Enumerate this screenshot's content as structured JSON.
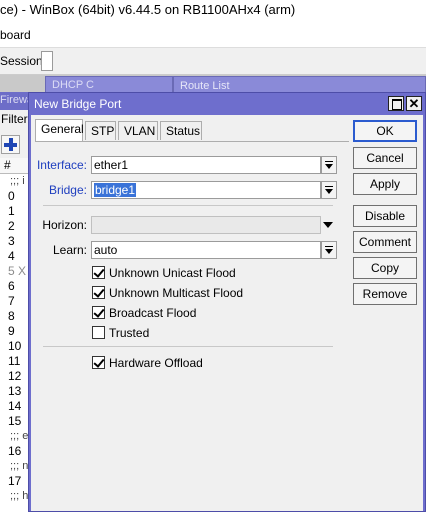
{
  "window": {
    "title": "ce) - WinBox (64bit) v6.44.5 on RB1100AHx4 (arm)",
    "menu_text": "board",
    "session_label": "Session:"
  },
  "background_windows": {
    "tab1": "DHCP C",
    "tab2": "Route List"
  },
  "left_panel": {
    "header": "Firewall",
    "filter": "Filter",
    "hash": "#",
    "rows": [
      {
        "text": ";;; i",
        "type": "comment"
      },
      {
        "text": "0",
        "type": "row"
      },
      {
        "text": "1",
        "type": "row"
      },
      {
        "text": "2",
        "type": "row"
      },
      {
        "text": "3",
        "type": "row"
      },
      {
        "text": "4",
        "type": "row"
      },
      {
        "text": "5 X",
        "type": "disabled"
      },
      {
        "text": "6",
        "type": "row"
      },
      {
        "text": "7",
        "type": "row"
      },
      {
        "text": "8",
        "type": "row"
      },
      {
        "text": "9",
        "type": "row"
      },
      {
        "text": "10",
        "type": "row"
      },
      {
        "text": "11",
        "type": "row"
      },
      {
        "text": "12",
        "type": "row"
      },
      {
        "text": "13",
        "type": "row"
      },
      {
        "text": "14",
        "type": "row"
      },
      {
        "text": "15",
        "type": "row"
      },
      {
        "text": ";;; e",
        "type": "comment"
      },
      {
        "text": "16",
        "type": "row"
      },
      {
        "text": ";;; n",
        "type": "comment"
      },
      {
        "text": "17",
        "type": "row"
      },
      {
        "text": ";;; h",
        "type": "comment"
      }
    ]
  },
  "dialog": {
    "title": "New Bridge Port",
    "close_glyph": "✕",
    "tabs": [
      "General",
      "STP",
      "VLAN",
      "Status"
    ],
    "fields": {
      "interface": {
        "label": "Interface:",
        "value": "ether1"
      },
      "bridge": {
        "label": "Bridge:",
        "value": "bridge1"
      },
      "horizon": {
        "label": "Horizon:",
        "value": ""
      },
      "learn": {
        "label": "Learn:",
        "value": "auto"
      }
    },
    "checkboxes": {
      "unknown_unicast_flood": {
        "label": "Unknown Unicast Flood",
        "checked": true
      },
      "unknown_multicast_flood": {
        "label": "Unknown Multicast Flood",
        "checked": true
      },
      "broadcast_flood": {
        "label": "Broadcast Flood",
        "checked": true
      },
      "trusted": {
        "label": "Trusted",
        "checked": false
      },
      "hardware_offload": {
        "label": "Hardware Offload",
        "checked": true
      }
    },
    "buttons": {
      "ok": "OK",
      "cancel": "Cancel",
      "apply": "Apply",
      "disable": "Disable",
      "comment": "Comment",
      "copy": "Copy",
      "remove": "Remove"
    }
  },
  "colors": {
    "dialog_frame": "#6e6ecd",
    "label_blue": "#1f3fbf",
    "selection": "#3a73d8",
    "plus_icon": "#1f46b4"
  }
}
